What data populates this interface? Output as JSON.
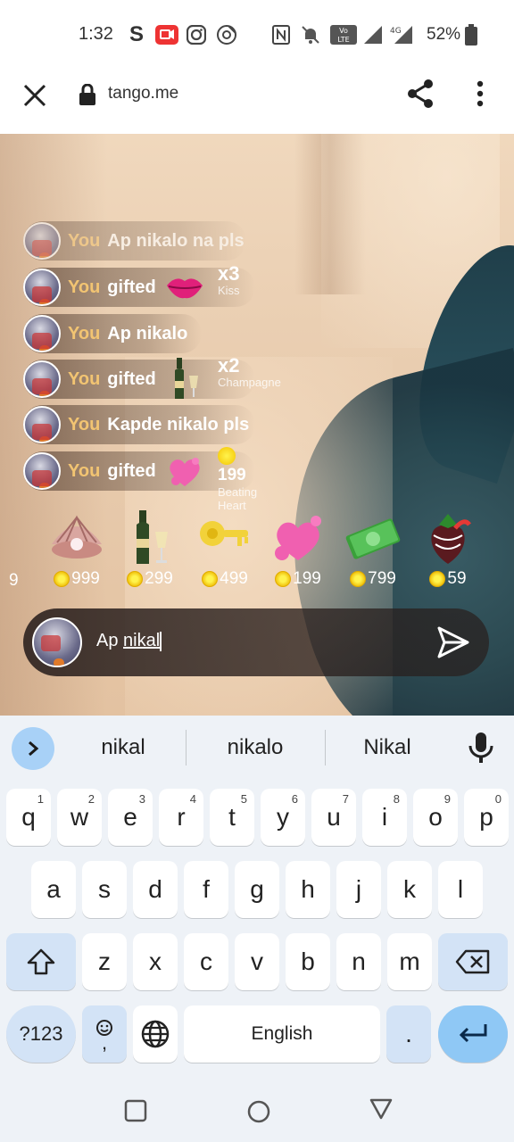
{
  "status_bar": {
    "time": "1:32",
    "network": "4G",
    "battery": "52%",
    "icons": [
      "s-app-icon",
      "youtube-icon",
      "instagram-icon",
      "music-icon",
      "nfc-icon",
      "mute-icon",
      "volte-icon",
      "signal-icon",
      "battery-icon"
    ]
  },
  "browser": {
    "url": "tango.me"
  },
  "chat": {
    "messages": [
      {
        "user": "You",
        "text": "Ap nikalo na pls"
      },
      {
        "user": "You",
        "text": "gifted",
        "gift_count": "x3",
        "gift_name": "Kiss"
      },
      {
        "user": "You",
        "text": "Ap nikalo"
      },
      {
        "user": "You",
        "text": "gifted",
        "gift_count": "x2",
        "gift_name": "Champagne"
      },
      {
        "user": "You",
        "text": "Kapde nikalo pls"
      },
      {
        "user": "You",
        "text": "gifted",
        "gift_count": "199",
        "gift_name": "Beating Heart"
      }
    ]
  },
  "gifts": [
    {
      "icon": "pearl-shell-icon",
      "price": "999"
    },
    {
      "icon": "champagne-icon",
      "price": "299"
    },
    {
      "icon": "gold-key-icon",
      "price": "499"
    },
    {
      "icon": "beating-heart-icon",
      "price": "199"
    },
    {
      "icon": "money-icon",
      "price": "799"
    },
    {
      "icon": "strawberry-icon",
      "price": "59"
    }
  ],
  "gift_partial_price": "9",
  "comment": {
    "prefix": "Ap ",
    "composing": "nikal"
  },
  "keyboard": {
    "suggestions": [
      "nikal",
      "nikalo",
      "Nikal"
    ],
    "row1": [
      {
        "key": "q",
        "hint": "1"
      },
      {
        "key": "w",
        "hint": "2"
      },
      {
        "key": "e",
        "hint": "3"
      },
      {
        "key": "r",
        "hint": "4"
      },
      {
        "key": "t",
        "hint": "5"
      },
      {
        "key": "y",
        "hint": "6"
      },
      {
        "key": "u",
        "hint": "7"
      },
      {
        "key": "i",
        "hint": "8"
      },
      {
        "key": "o",
        "hint": "9"
      },
      {
        "key": "p",
        "hint": "0"
      }
    ],
    "row2": [
      "a",
      "s",
      "d",
      "f",
      "g",
      "h",
      "j",
      "k",
      "l"
    ],
    "row3": [
      "z",
      "x",
      "c",
      "v",
      "b",
      "n",
      "m"
    ],
    "sym_label": "?123",
    "emoji_label": ",",
    "space_label": "English",
    "period_label": "."
  }
}
